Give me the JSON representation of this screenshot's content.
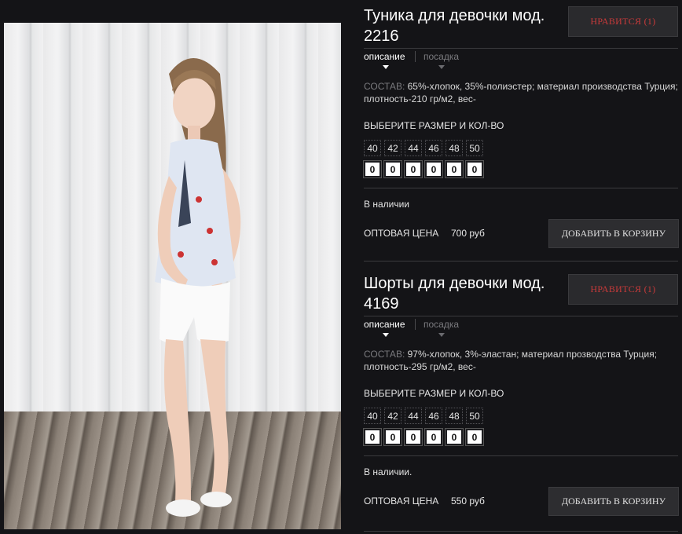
{
  "products": [
    {
      "title": "Туника для девочки мод. 2216",
      "like_label": "НРАВИТСЯ (1)",
      "tab_description": "описание",
      "tab_fit": "посадка",
      "composition_label": "СОСТАВ:",
      "composition_text": "65%-хлопок, 35%-полиэстер; материал производства Турция; плотность-210 гр/м2, вес-",
      "choose_label": "ВЫБЕРИТЕ РАЗМЕР И КОЛ-ВО",
      "sizes": [
        "40",
        "42",
        "44",
        "46",
        "48",
        "50"
      ],
      "quantities": [
        "0",
        "0",
        "0",
        "0",
        "0",
        "0"
      ],
      "availability": "В наличии",
      "price_label": "ОПТОВАЯ ЦЕНА",
      "price_value": "700 руб",
      "cart_label": "ДОБАВИТЬ В КОРЗИНУ"
    },
    {
      "title": "Шорты для девочки мод. 4169",
      "like_label": "НРАВИТСЯ (1)",
      "tab_description": "описание",
      "tab_fit": "посадка",
      "composition_label": "СОСТАВ:",
      "composition_text": "97%-хлопок, 3%-эластан; материал прозводства Турция; плотность-295 гр/м2, вес-",
      "choose_label": "ВЫБЕРИТЕ РАЗМЕР И КОЛ-ВО",
      "sizes": [
        "40",
        "42",
        "44",
        "46",
        "48",
        "50"
      ],
      "quantities": [
        "0",
        "0",
        "0",
        "0",
        "0",
        "0"
      ],
      "availability": "В наличии.",
      "price_label": "ОПТОВАЯ ЦЕНА",
      "price_value": "550 руб",
      "cart_label": "ДОБАВИТЬ В КОРЗИНУ"
    }
  ],
  "colors": {
    "background": "#141417",
    "like_text": "#c93a3a",
    "button_bg": "#2d2d30"
  }
}
